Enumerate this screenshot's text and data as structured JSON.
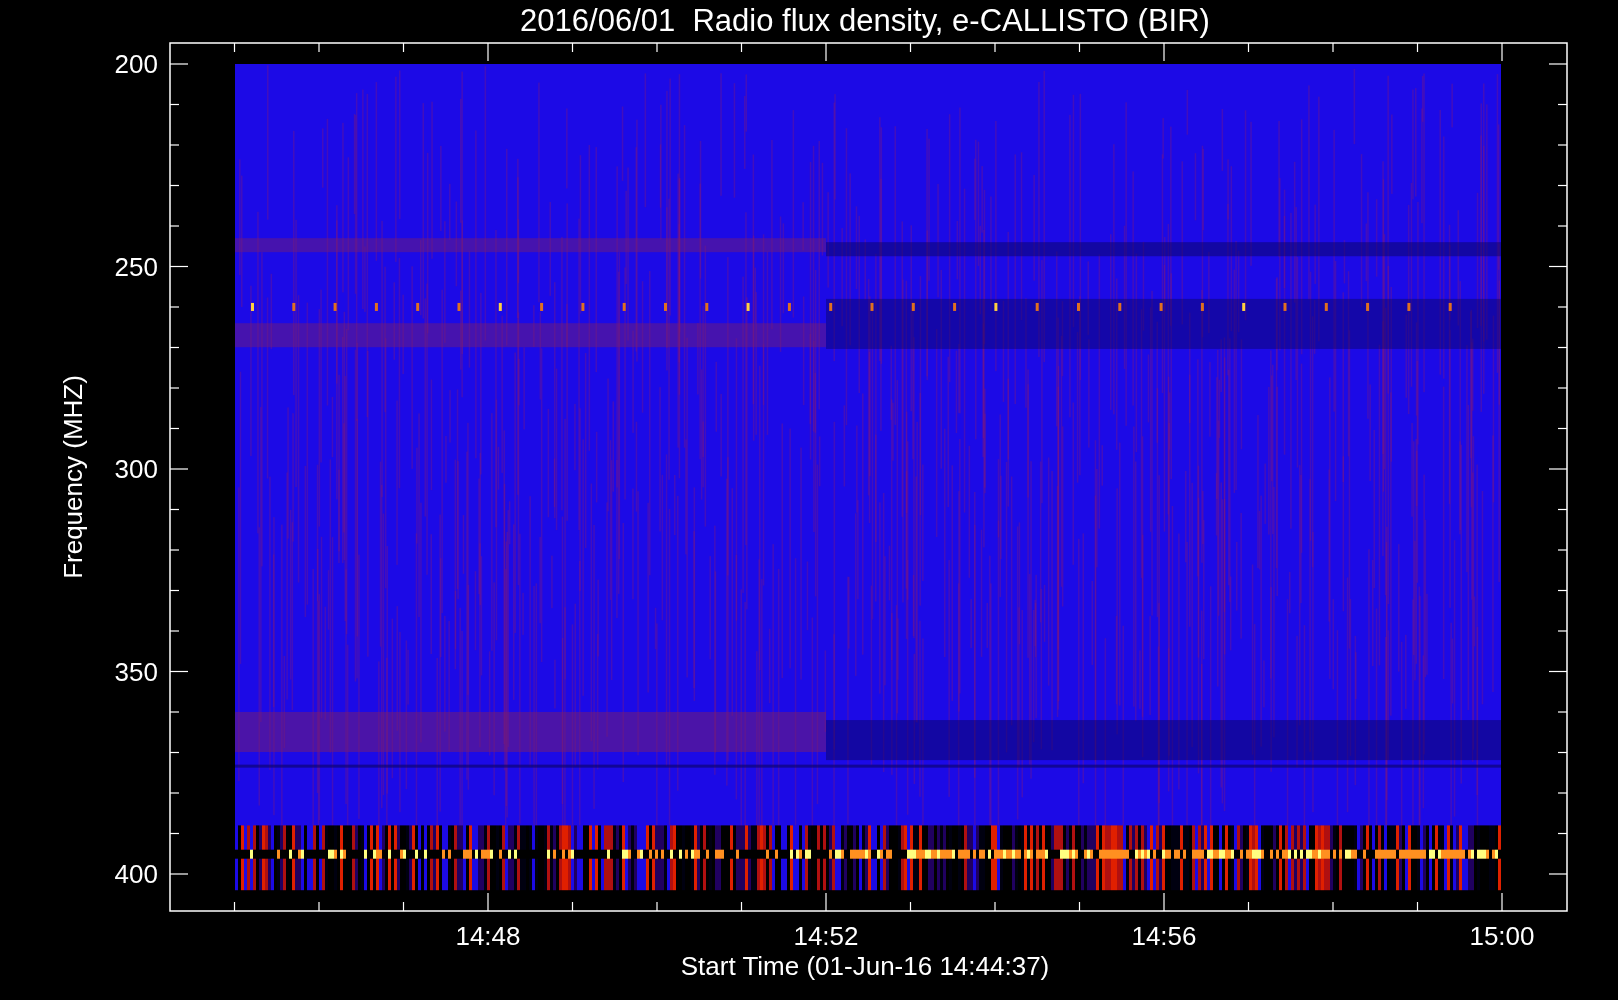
{
  "title": "2016/06/01  Radio flux density, e-CALLISTO (BIR)",
  "y_axis": {
    "label": "Frequency (MHZ)",
    "ticks": [
      "200",
      "250",
      "300",
      "350",
      "400"
    ]
  },
  "x_axis": {
    "label": "Start Time (01-Jun-16 14:44:37)",
    "ticks": [
      "14:48",
      "14:52",
      "14:56",
      "15:00"
    ]
  }
}
